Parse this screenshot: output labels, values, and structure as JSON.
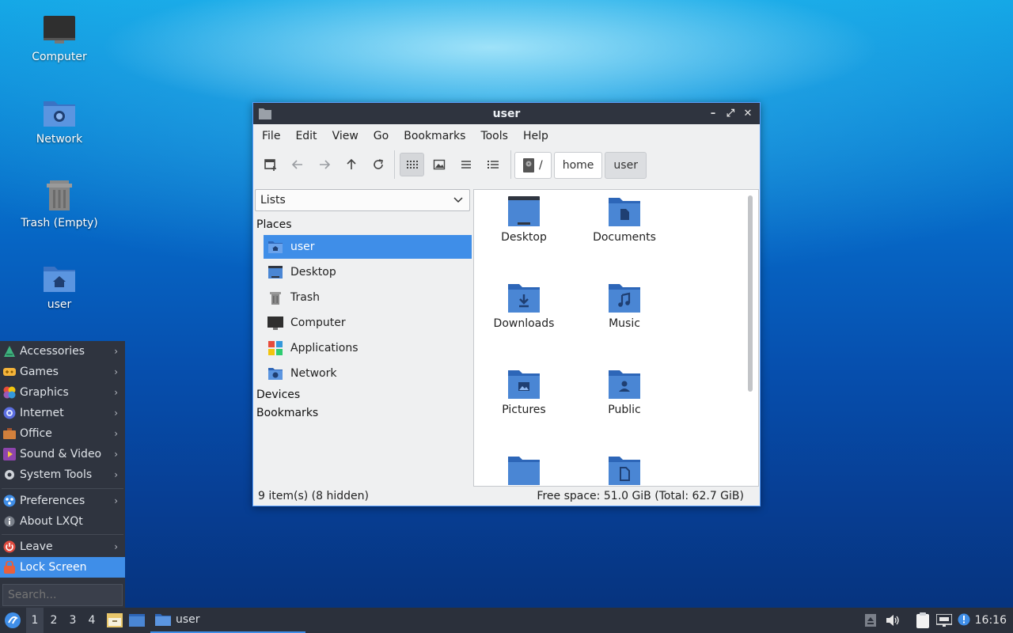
{
  "desktop": {
    "icons": [
      {
        "label": "Computer",
        "icon": "computer-icon"
      },
      {
        "label": "Network",
        "icon": "network-folder-icon"
      },
      {
        "label": "Trash (Empty)",
        "icon": "trash-icon"
      },
      {
        "label": "user",
        "icon": "home-folder-icon"
      }
    ]
  },
  "window": {
    "title": "user",
    "menu": [
      "File",
      "Edit",
      "View",
      "Go",
      "Bookmarks",
      "Tools",
      "Help"
    ],
    "breadcrumbs": [
      "/",
      "home",
      "user"
    ],
    "side_select": "Lists",
    "places_heading": "Places",
    "places": [
      "user",
      "Desktop",
      "Trash",
      "Computer",
      "Applications",
      "Network"
    ],
    "devices_heading": "Devices",
    "bookmarks_heading": "Bookmarks",
    "files": [
      "Desktop",
      "Documents",
      "Downloads",
      "Music",
      "Pictures",
      "Public"
    ],
    "status_left": "9 item(s) (8 hidden)",
    "status_right": "Free space: 51.0 GiB (Total: 62.7 GiB)"
  },
  "app_menu": {
    "categories": [
      "Accessories",
      "Games",
      "Graphics",
      "Internet",
      "Office",
      "Sound & Video",
      "System Tools"
    ],
    "preferences": "Preferences",
    "about": "About LXQt",
    "leave": "Leave",
    "lock": "Lock Screen",
    "search_placeholder": "Search..."
  },
  "taskbar": {
    "desktops": [
      "1",
      "2",
      "3",
      "4"
    ],
    "task_label": "user",
    "clock": "16:16"
  },
  "colors": {
    "accent": "#3f8ee8",
    "folder": "#4a86d4",
    "panel": "#2f343f"
  }
}
